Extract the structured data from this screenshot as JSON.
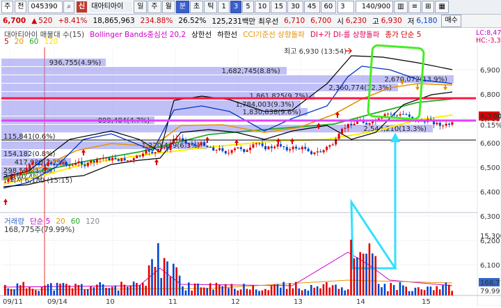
{
  "toolbar": {
    "market": "주",
    "period_type": "전",
    "code": "045390",
    "sin_badge": "신",
    "name": "대아티아이",
    "periods": [
      "일",
      "주",
      "월",
      "분",
      "초",
      "틱",
      "1",
      "3",
      "5",
      "10",
      "15",
      "30",
      "45",
      "60"
    ],
    "active_periods": [
      "분",
      "3"
    ],
    "interval_value": "3",
    "count": "140/900",
    "right_buttons": [
      "⊞",
      "≡",
      "⊞",
      "⊞"
    ]
  },
  "quote": {
    "price": "6,700",
    "change": "520",
    "change_pct": "+8.41%",
    "volume": "18,865,963",
    "vol_ratio": "234.88%",
    "turnover": "26.52%",
    "amount": "125,231백만",
    "best_sell_label": "최우선",
    "best_sell": "6,710",
    "best_buy": "6,700",
    "low_label": "시",
    "low": "6,230",
    "high_label": "고",
    "high": "6,930",
    "open_label": "저",
    "open": "6,180",
    "more_label": "매수"
  },
  "legend": {
    "main_items": [
      {
        "text": "대아티아이 매물대 수(15)",
        "color": "#444444"
      },
      {
        "text": "Bollinger Bands중심선 20,2",
        "color": "#cc00cc"
      },
      {
        "text": "상한선",
        "color": "#000000"
      },
      {
        "text": "하한선",
        "color": "#000000"
      },
      {
        "text": "CCI기준선 상향돌파",
        "color": "#e69500"
      },
      {
        "text": "DI+가 DI-를 상향돌파",
        "color": "#dd0055"
      },
      {
        "text": "종가 단순 5",
        "color": "#cc0000"
      }
    ],
    "ma_items": [
      {
        "text": "5",
        "color": "#cc0000"
      },
      {
        "text": "20",
        "color": "#e69500"
      },
      {
        "text": "60",
        "color": "#22aa22"
      },
      {
        "text": "120",
        "color": "#ffdd00"
      }
    ],
    "right_overflow": "​LC:8,47",
    "right_hc": "HC:-3,3"
  },
  "chart_data": {
    "type": "candlestick",
    "y_ticks": [
      "6,900",
      "6,800",
      "6,700",
      "6,600",
      "6,500",
      "6,400",
      "6,300",
      "6,200",
      "6,100"
    ],
    "price_tag": "6,700",
    "pct_tag": "0.15%",
    "volume_profile": [
      {
        "label": "936,755(4.9%)"
      },
      {
        "label": "1,682,745(8.8%)"
      },
      {
        "label": "2,670,072(13.9%)"
      },
      {
        "label": "2,360,774(12.3%)"
      },
      {
        "label": "1,861,825(9.7%)"
      },
      {
        "label": "1,784,003(9.3%)"
      },
      {
        "label": "1,830,838(9.6%)"
      },
      {
        "label": "899,484(4.7%)"
      },
      {
        "label": "2,544,210(13.3%)"
      },
      {
        "label": "115,841(0.6%)"
      },
      {
        "label": "1,220,449(6.3%)"
      },
      {
        "label": "154,182(0.8%)"
      },
      {
        "label": "417,920(2.2%)"
      },
      {
        "label": "298,598(1.6%)"
      },
      {
        "label": "7,7..(0.4%)"
      }
    ],
    "high_annotation": "최고 6,930 (13:54)",
    "low_annotation": "최저 6,180 (15:15)",
    "x_ticks": [
      "09/11",
      "09/14",
      "10",
      "11",
      "12",
      "13",
      "14",
      "15"
    ],
    "volume_legend": [
      {
        "text": "거래량",
        "color": "#3366cc"
      },
      {
        "text": "단순 5",
        "color": "#cc00cc"
      },
      {
        "text": "20",
        "color": "#e69500"
      },
      {
        "text": "60",
        "color": "#22aa22"
      },
      {
        "text": "120",
        "color": "#888888"
      }
    ],
    "volume_value": "168,775주(79.99%)",
    "volume_y_ticks": [
      "15,300"
    ],
    "volume_tag": "168,77",
    "volume_tag2": "79.99"
  }
}
